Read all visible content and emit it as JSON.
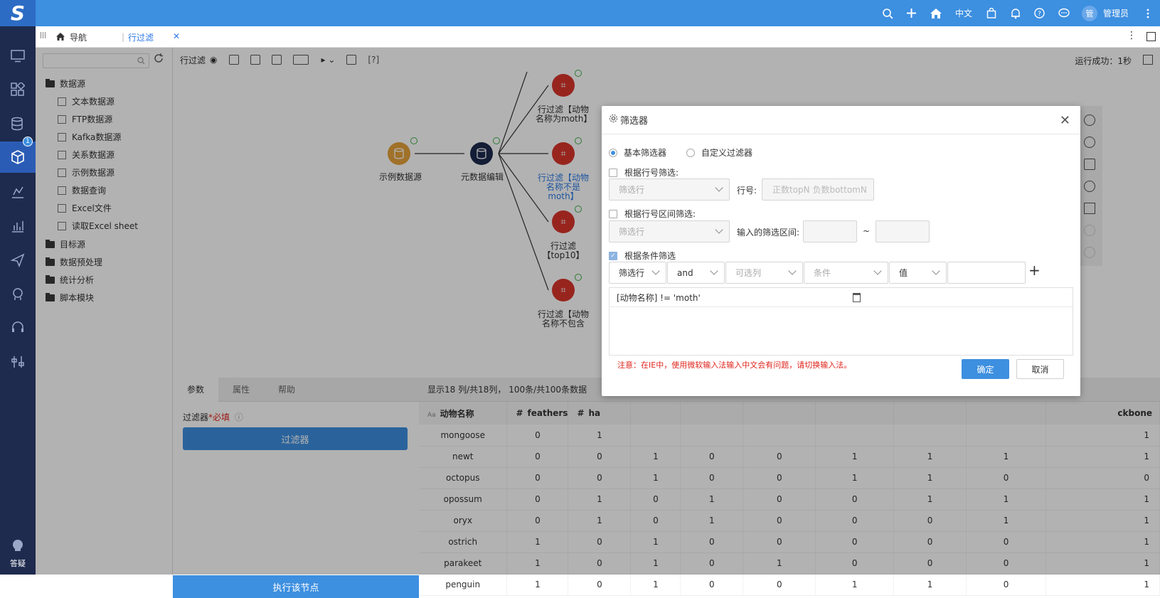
{
  "app": {
    "logo": "S"
  },
  "header": {
    "lang": "中文",
    "avatar": "管",
    "user": "管理员"
  },
  "sidebar": {
    "badge": "1",
    "help_label": "答疑"
  },
  "tabs": {
    "home_label": "导航",
    "current": "行过滤",
    "close": "✕"
  },
  "tree": {
    "groups": [
      {
        "label": "数据源",
        "children": [
          "文本数据源",
          "FTP数据源",
          "Kafka数据源",
          "关系数据源",
          "示例数据源",
          "数据查询",
          "Excel文件",
          "读取Excel sheet"
        ]
      },
      {
        "label": "目标源"
      },
      {
        "label": "数据预处理"
      },
      {
        "label": "统计分析"
      },
      {
        "label": "脚本模块"
      }
    ]
  },
  "toolbar": {
    "title": "行过滤",
    "help": "[?]",
    "status": "运行成功：1秒"
  },
  "flow": {
    "n1": "示例数据源",
    "n2": "元数据编辑",
    "n3": "行过滤【动物名称为moth】",
    "n4": "行过滤【动物名称不是moth】",
    "n5": "行过滤【top10】",
    "n6": "行过滤【动物名称不包含"
  },
  "panel": {
    "tabs": [
      "参数",
      "属性",
      "帮助"
    ],
    "filter_label": "过滤器",
    "required": "*必填",
    "filter_button": "过滤器",
    "exec_button": "执行该节点"
  },
  "grid": {
    "info": "显示18 列/共18列， 100条/共100条数据",
    "columns": [
      "动物名称",
      "feathers",
      "ha",
      "",
      "",
      "",
      "",
      "",
      "",
      "ckbone"
    ],
    "rows": [
      [
        "mongoose",
        "0",
        "1",
        "",
        "",
        "",
        "",
        "",
        "",
        "1"
      ],
      [
        "newt",
        "0",
        "0",
        "1",
        "0",
        "0",
        "1",
        "1",
        "1",
        "1"
      ],
      [
        "octopus",
        "0",
        "0",
        "1",
        "0",
        "0",
        "1",
        "1",
        "0",
        "0"
      ],
      [
        "opossum",
        "0",
        "1",
        "0",
        "1",
        "0",
        "0",
        "1",
        "1",
        "1"
      ],
      [
        "oryx",
        "0",
        "1",
        "0",
        "1",
        "0",
        "0",
        "0",
        "1",
        "1"
      ],
      [
        "ostrich",
        "1",
        "0",
        "1",
        "0",
        "0",
        "0",
        "0",
        "0",
        "1"
      ],
      [
        "parakeet",
        "1",
        "0",
        "1",
        "0",
        "1",
        "0",
        "0",
        "0",
        "1"
      ],
      [
        "penguin",
        "1",
        "0",
        "1",
        "0",
        "0",
        "1",
        "1",
        "0",
        "1"
      ]
    ]
  },
  "dialog": {
    "title": "筛选器",
    "radio_basic": "基本筛选器",
    "radio_custom": "自定义过滤器",
    "by_row": "根据行号筛选:",
    "row_select": "筛选行",
    "row_no_label": "行号:",
    "row_no_placeholder": "正数topN 负数bottomN",
    "by_range": "根据行号区间筛选:",
    "range_select": "筛选行",
    "range_label": "输入的筛选区间:",
    "tilde": "~",
    "by_condition": "根据条件筛选",
    "cond_row": "筛选行",
    "cond_logic": "and",
    "cond_column": "可选列",
    "cond_op": "条件",
    "cond_value_type": "值",
    "condition_text": "[动物名称] != 'moth'",
    "warning": "注意：在IE中，使用微软输入法输入中文会有问题，请切换输入法。",
    "ok": "确定",
    "cancel": "取消"
  },
  "colors": {
    "accent": "#3d8fe0",
    "sidebar": "#1e2a4e",
    "warning": "#e0241c"
  }
}
